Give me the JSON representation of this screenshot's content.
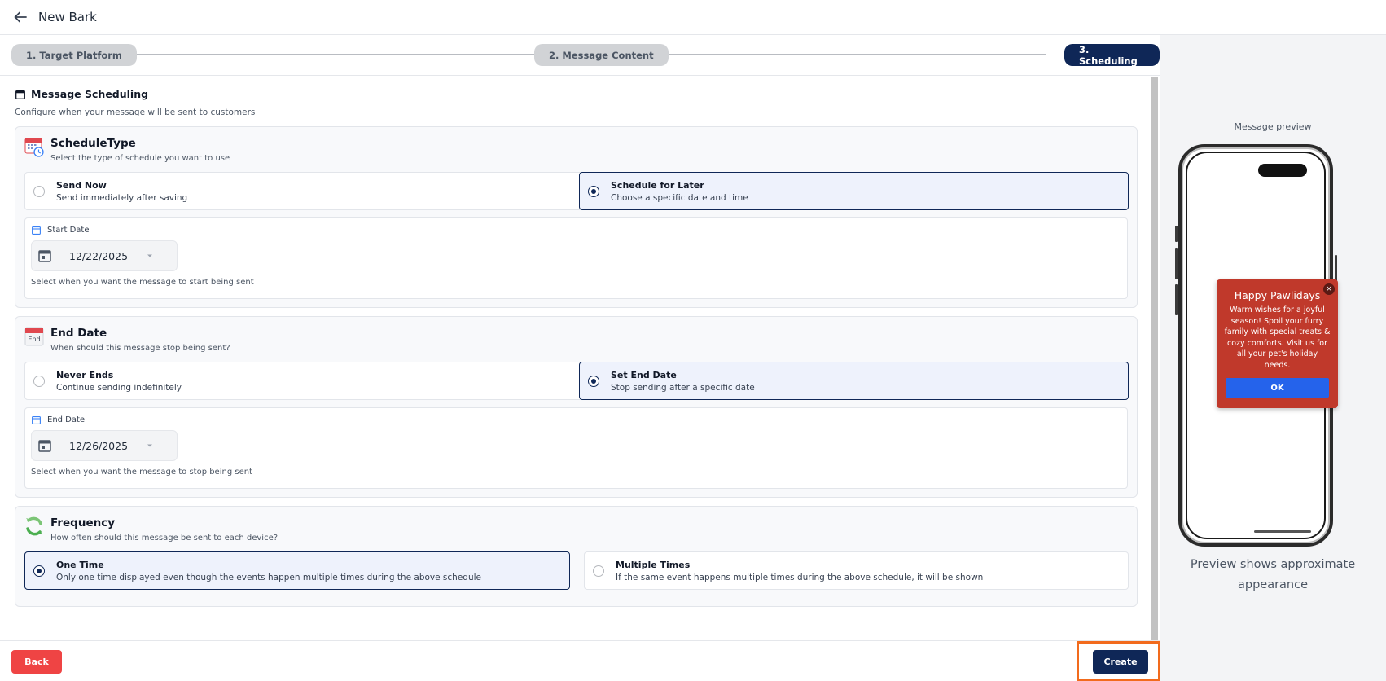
{
  "header": {
    "title": "New Bark"
  },
  "stepper": {
    "step1": "1. Target Platform",
    "step2": "2. Message Content",
    "step3": "3. Scheduling"
  },
  "section": {
    "title": "Message Scheduling",
    "subtitle": "Configure when your message will be sent to customers"
  },
  "schedule_type": {
    "title": "ScheduleType",
    "subtitle": "Select the type of schedule you want to use",
    "options": [
      {
        "label": "Send Now",
        "desc": "Send immediately after saving",
        "selected": false
      },
      {
        "label": "Schedule for Later",
        "desc": "Choose a specific date and time",
        "selected": true
      }
    ],
    "date_label": "Start Date",
    "date_value": "12/22/2025",
    "date_help": "Select when you want the message to start being sent"
  },
  "end_date": {
    "title": "End Date",
    "icon_text": "End",
    "subtitle": "When should this message stop being sent?",
    "options": [
      {
        "label": "Never Ends",
        "desc": "Continue sending indefinitely",
        "selected": false
      },
      {
        "label": "Set End Date",
        "desc": "Stop sending after a specific date",
        "selected": true
      }
    ],
    "date_label": "End Date",
    "date_value": "12/26/2025",
    "date_help": "Select when you want the message to stop being sent"
  },
  "frequency": {
    "title": "Frequency",
    "subtitle": "How often should this message be sent to each device?",
    "options": [
      {
        "label": "One Time",
        "desc": "Only one time displayed even though the events happen multiple times during the above schedule",
        "selected": true
      },
      {
        "label": "Multiple Times",
        "desc": "If the same event happens multiple times during the above schedule, it will be shown",
        "selected": false
      }
    ]
  },
  "footer": {
    "back": "Back",
    "create": "Create"
  },
  "preview": {
    "label": "Message preview",
    "popup_title": "Happy Pawlidays",
    "popup_body": "Warm wishes for a joyful season! Spoil your furry family with special treats & cozy comforts. Visit us for all your pet's holiday needs.",
    "popup_close": "×",
    "popup_ok": "OK",
    "note": "Preview shows approximate appearance"
  },
  "colors": {
    "primary": "#0f2757",
    "danger": "#ef4444",
    "popup_bg": "#c0392b",
    "popup_button": "#2563eb",
    "highlight": "#f26b1d"
  }
}
